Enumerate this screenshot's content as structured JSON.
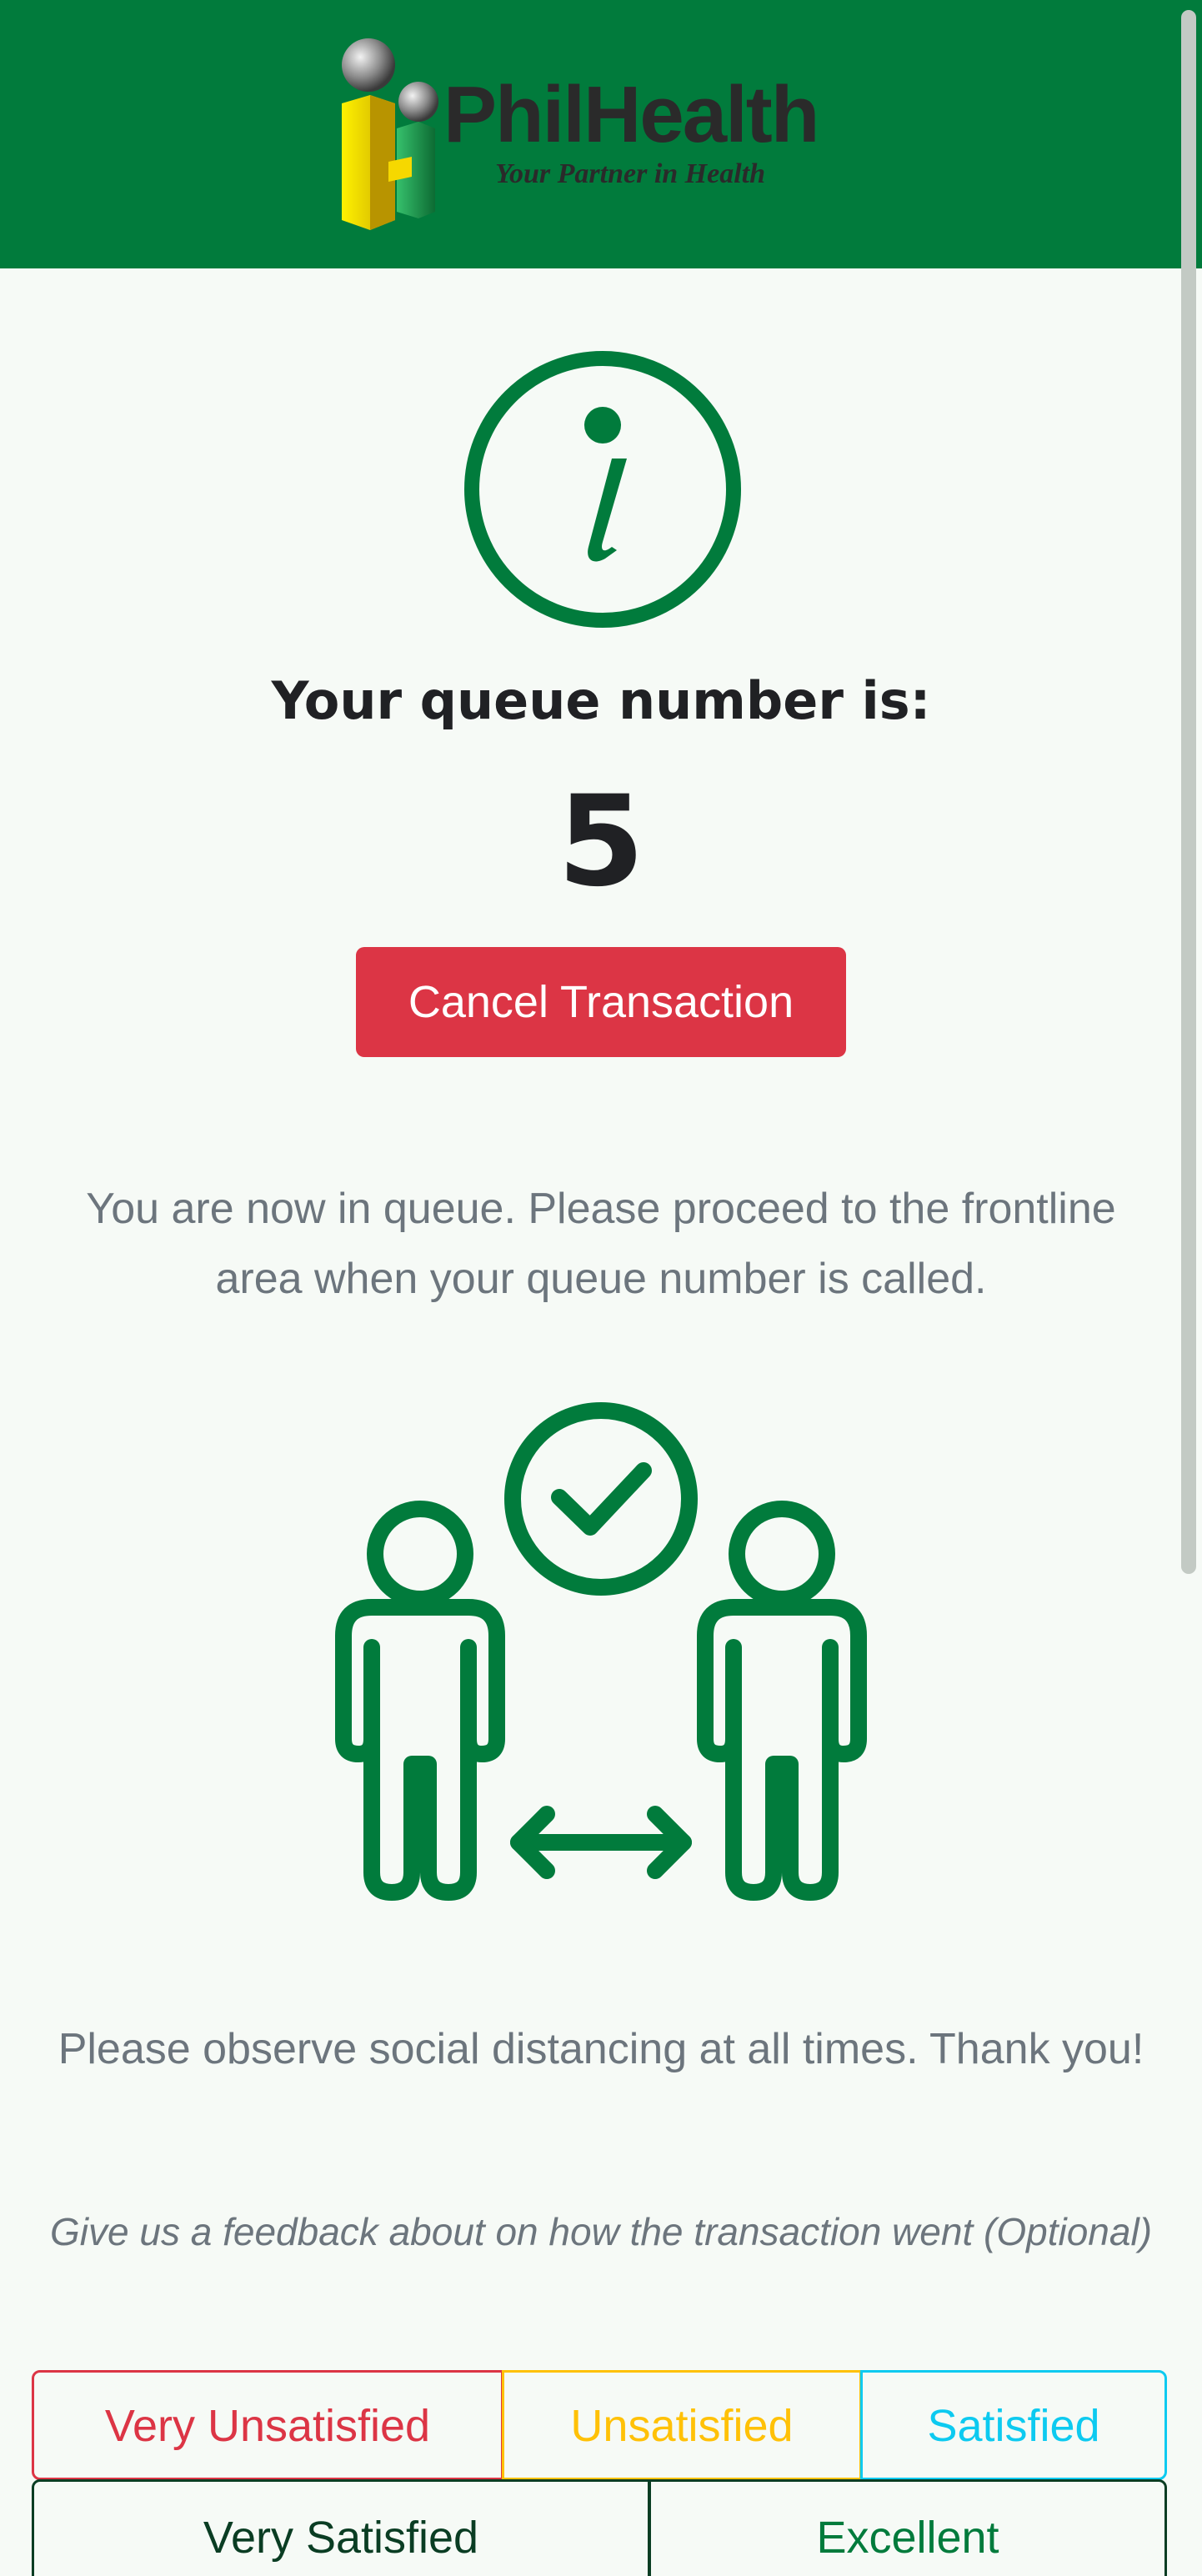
{
  "header": {
    "logo": {
      "brand": "PhilHealth",
      "tagline": "Your Partner in Health"
    },
    "background_color": "#017b3c"
  },
  "status": {
    "icon": "info-icon",
    "heading": "Your queue number is:",
    "queue_number": "5"
  },
  "actions": {
    "cancel_label": "Cancel Transaction",
    "cancel_color": "#dc3545"
  },
  "messages": {
    "queue_message": "You are now in queue. Please proceed to the frontline area when your queue number is called.",
    "distancing_message": "Please observe social distancing at all times. Thank you!"
  },
  "illustration": {
    "icon": "social-distancing-icon"
  },
  "feedback": {
    "prompt": "Give us a feedback about on how the transaction went (Optional)",
    "options": [
      {
        "label": "Very Unsatisfied",
        "color": "#dc3545"
      },
      {
        "label": "Unsatisfied",
        "color": "#ffc107"
      },
      {
        "label": "Satisfied",
        "color": "#0dcaf0"
      },
      {
        "label": "Very Satisfied",
        "color": "#0a3d23"
      },
      {
        "label": "Excellent",
        "color": "#017b3c"
      }
    ]
  },
  "theme": {
    "accent_green": "#017b3c",
    "page_background": "#f6faf6",
    "muted_text": "#6c757d"
  }
}
